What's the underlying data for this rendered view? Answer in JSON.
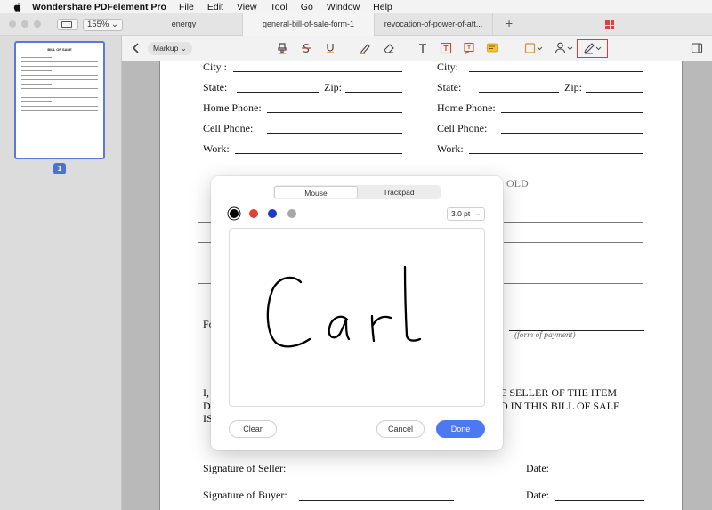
{
  "menubar": {
    "app_name": "Wondershare PDFelement Pro",
    "items": [
      "File",
      "Edit",
      "View",
      "Tool",
      "Go",
      "Window",
      "Help"
    ]
  },
  "tabbar": {
    "zoom": "155%",
    "tabs": [
      {
        "label": "energy",
        "active": false
      },
      {
        "label": "general-bill-of-sale-form-1",
        "active": true
      },
      {
        "label": "revocation-of-power-of-att...",
        "active": false
      }
    ],
    "new_tab": "+"
  },
  "sidebar": {
    "thumbnail_title": "BILL OF SALE",
    "page_number": "1"
  },
  "toolbar": {
    "markup_label": "Markup",
    "icons": [
      "back-icon",
      "highlight-icon",
      "strikethrough-icon",
      "underline-icon",
      "pencil-icon",
      "eraser-icon",
      "text-icon",
      "textbox-icon",
      "callout-icon",
      "note-icon",
      "shape-icon",
      "stamp-icon",
      "signature-icon",
      "panel-icon"
    ]
  },
  "document": {
    "left": {
      "city": "City :",
      "state": "State:",
      "zip": "Zip:",
      "home_phone": "Home Phone:",
      "cell_phone": "Cell Phone:",
      "work": "Work:"
    },
    "right": {
      "city": "City:",
      "state": "State:",
      "zip": "Zip:",
      "home_phone": "Home Phone:",
      "cell_phone": "Cell Phone:",
      "work": "Work:"
    },
    "sold_fragment": "OLD",
    "fo_fragment": "Fo",
    "form_of_payment": "(form of payment)",
    "para_line1_left": "I,",
    "para_line1_right": "E SELLER OF THE ITEM",
    "para_line2_left": "D",
    "para_line2_right": "D IN THIS BILL OF SALE",
    "para_line3_left": "IS",
    "sig_seller": "Signature of Seller:",
    "sig_buyer": "Signature of Buyer:",
    "date1": "Date:",
    "date2": "Date:"
  },
  "signature_dialog": {
    "tabs": [
      "Mouse",
      "Trackpad"
    ],
    "active_tab": "Mouse",
    "colors": [
      "#000000",
      "#e0403a",
      "#1a3cc8",
      "#a8a8a8"
    ],
    "selected_color": "#000000",
    "stroke_width": "3.0 pt",
    "clear_label": "Clear",
    "cancel_label": "Cancel",
    "done_label": "Done",
    "accent": "#4e78f2"
  }
}
